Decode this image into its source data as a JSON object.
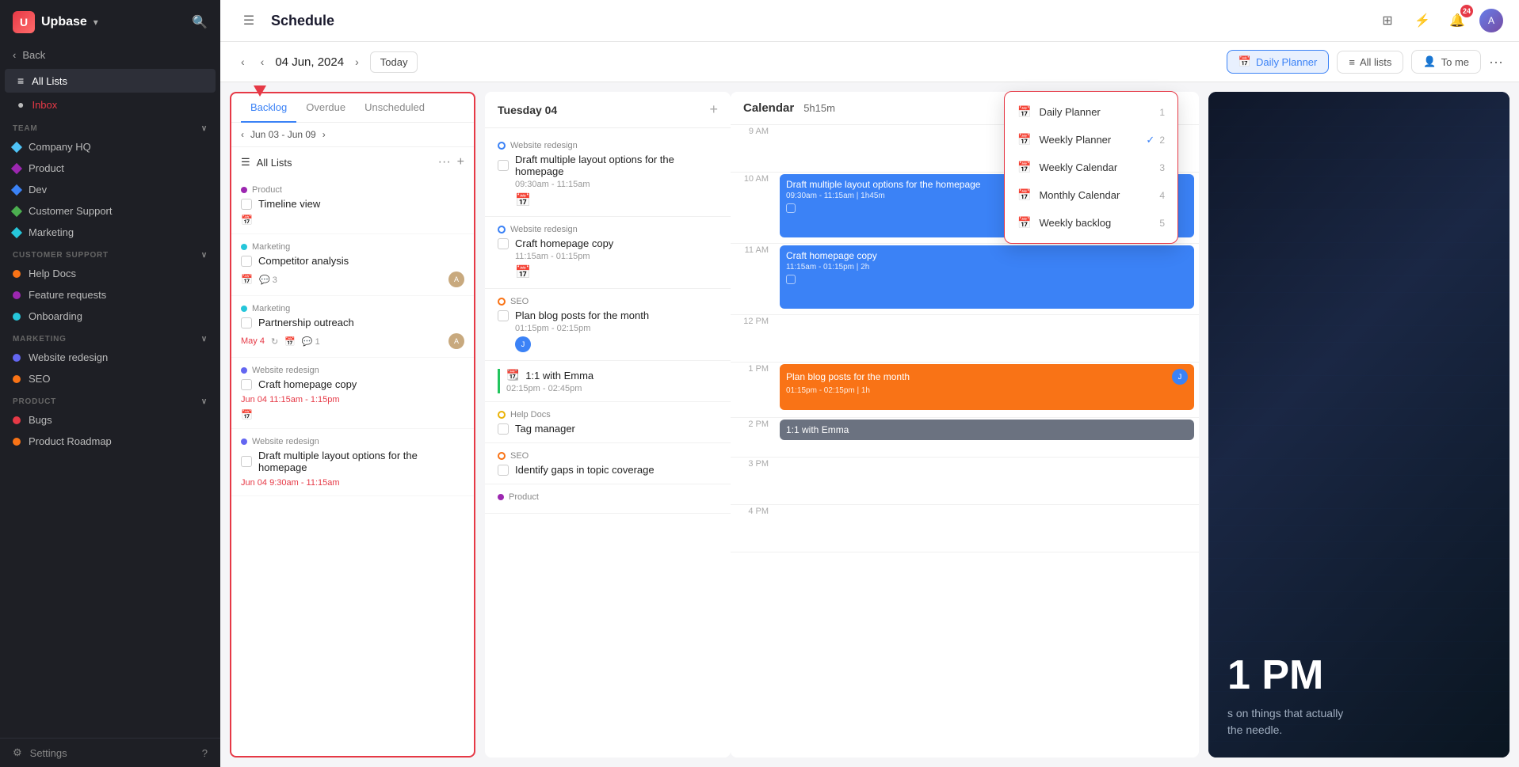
{
  "app": {
    "name": "Upbase",
    "page_title": "Schedule"
  },
  "topbar": {
    "menu_icon": "☰",
    "grid_icon": "⊞",
    "bolt_icon": "⚡",
    "bell_icon": "🔔",
    "notification_count": "24"
  },
  "schedule_bar": {
    "date": "04 Jun, 2024",
    "today_label": "Today",
    "active_view": "Daily Planner",
    "views": [
      {
        "label": "Daily Planner",
        "icon": "📅",
        "active": true
      },
      {
        "label": "All lists",
        "icon": "☰",
        "active": false
      },
      {
        "label": "To me",
        "icon": "👤",
        "active": false
      }
    ]
  },
  "sidebar": {
    "logo": "U",
    "logo_text": "Upbase",
    "back_label": "Back",
    "all_lists_label": "All Lists",
    "inbox_label": "Inbox",
    "team_section": "TEAM",
    "team_items": [
      {
        "label": "Company HQ",
        "color": "#26c6da",
        "shape": "diamond"
      },
      {
        "label": "Product",
        "color": "#9c27b0",
        "shape": "diamond"
      },
      {
        "label": "Dev",
        "color": "#3b82f6",
        "shape": "diamond"
      },
      {
        "label": "Customer Support",
        "color": "#4caf50",
        "shape": "diamond"
      },
      {
        "label": "Marketing",
        "color": "#26c6da",
        "shape": "diamond"
      }
    ],
    "customer_support_section": "CUSTOMER SUPPORT",
    "customer_support_items": [
      {
        "label": "Help Docs",
        "color": "#f97316"
      },
      {
        "label": "Feature requests",
        "color": "#9c27b0"
      },
      {
        "label": "Onboarding",
        "color": "#26c6da"
      }
    ],
    "marketing_section": "MARKETING",
    "marketing_items": [
      {
        "label": "Website redesign",
        "color": "#6366f1"
      },
      {
        "label": "SEO",
        "color": "#f97316"
      }
    ],
    "product_section": "PRODUCT",
    "product_items": [
      {
        "label": "Bugs",
        "color": "#e63946"
      },
      {
        "label": "Product Roadmap",
        "color": "#f97316"
      }
    ],
    "settings_label": "Settings"
  },
  "backlog": {
    "tabs": [
      "Backlog",
      "Overdue",
      "Unscheduled"
    ],
    "active_tab": "Backlog",
    "date_range": "Jun 03 - Jun 09",
    "list_title": "All Lists",
    "items": [
      {
        "category": "Product",
        "category_color": "#9c27b0",
        "title": "Timeline view",
        "has_calendar": true,
        "meta": []
      },
      {
        "category": "Marketing",
        "category_color": "#26c6da",
        "title": "Competitor analysis",
        "has_calendar": true,
        "comment_count": "3",
        "has_avatar": true
      },
      {
        "category": "Marketing",
        "category_color": "#26c6da",
        "title": "Partnership outreach",
        "meta_date": "May 4",
        "comment_count": "1",
        "has_avatar": true
      },
      {
        "category": "Website redesign",
        "category_color": "#6366f1",
        "title": "Craft homepage copy",
        "date_time": "Jun 04 11:15am - 1:15pm",
        "has_calendar": true
      },
      {
        "category": "Website redesign",
        "category_color": "#6366f1",
        "title": "Draft multiple layout options for the homepage",
        "date_time": "Jun 04 9:30am - 11:15am"
      }
    ]
  },
  "tuesday": {
    "title": "Tuesday 04",
    "items": [
      {
        "category": "Website redesign",
        "indicator": "blue",
        "title": "Draft multiple layout options for the homepage",
        "time": "09:30am - 11:15am",
        "has_icon": true
      },
      {
        "category": "Website redesign",
        "indicator": "blue",
        "title": "Craft homepage copy",
        "time": "11:15am - 01:15pm",
        "has_icon": true
      },
      {
        "category": "SEO",
        "indicator": "orange",
        "title": "Plan blog posts for the month",
        "time": "01:15pm - 02:15pm",
        "has_avatar": true
      },
      {
        "category": "",
        "title": "1:1 with Emma",
        "time": "02:15pm - 02:45pm",
        "border_color": "green"
      },
      {
        "category": "Help Docs",
        "indicator": "yellow",
        "title": "Tag manager",
        "time": ""
      },
      {
        "category": "SEO",
        "indicator": "orange",
        "title": "Identify gaps in topic coverage",
        "time": ""
      },
      {
        "category": "Product",
        "indicator": "purple",
        "title": "",
        "time": ""
      }
    ]
  },
  "calendar": {
    "title": "Calendar",
    "duration": "5h15m",
    "time_slots": [
      "9 AM",
      "10 AM",
      "11 AM",
      "12 PM",
      "1 PM",
      "2 PM",
      "3 PM",
      "4 PM"
    ],
    "events": [
      {
        "title": "Draft multiple layout options for the homepage",
        "time": "09:30am - 11:15am | 1h45m",
        "color": "blue",
        "slot": "10am"
      },
      {
        "title": "Craft homepage copy",
        "time": "11:15am - 01:15pm | 2h",
        "color": "blue",
        "slot": "11am"
      },
      {
        "title": "Plan blog posts for the month",
        "time": "01:15pm - 02:15pm | 1h",
        "color": "orange",
        "slot": "1pm"
      },
      {
        "title": "1:1 with Emma",
        "time": "",
        "color": "green",
        "slot": "2pm"
      }
    ]
  },
  "promo": {
    "time": "1 PM",
    "text_1": "s on things that actually",
    "text_2": "the needle."
  },
  "dropdown": {
    "items": [
      {
        "label": "Daily Planner",
        "num": "1",
        "checked": false
      },
      {
        "label": "Weekly Planner",
        "num": "2",
        "checked": true
      },
      {
        "label": "Weekly Calendar",
        "num": "3",
        "checked": false
      },
      {
        "label": "Monthly Calendar",
        "num": "4",
        "checked": false
      },
      {
        "label": "Weekly backlog",
        "num": "5",
        "checked": false
      }
    ]
  }
}
